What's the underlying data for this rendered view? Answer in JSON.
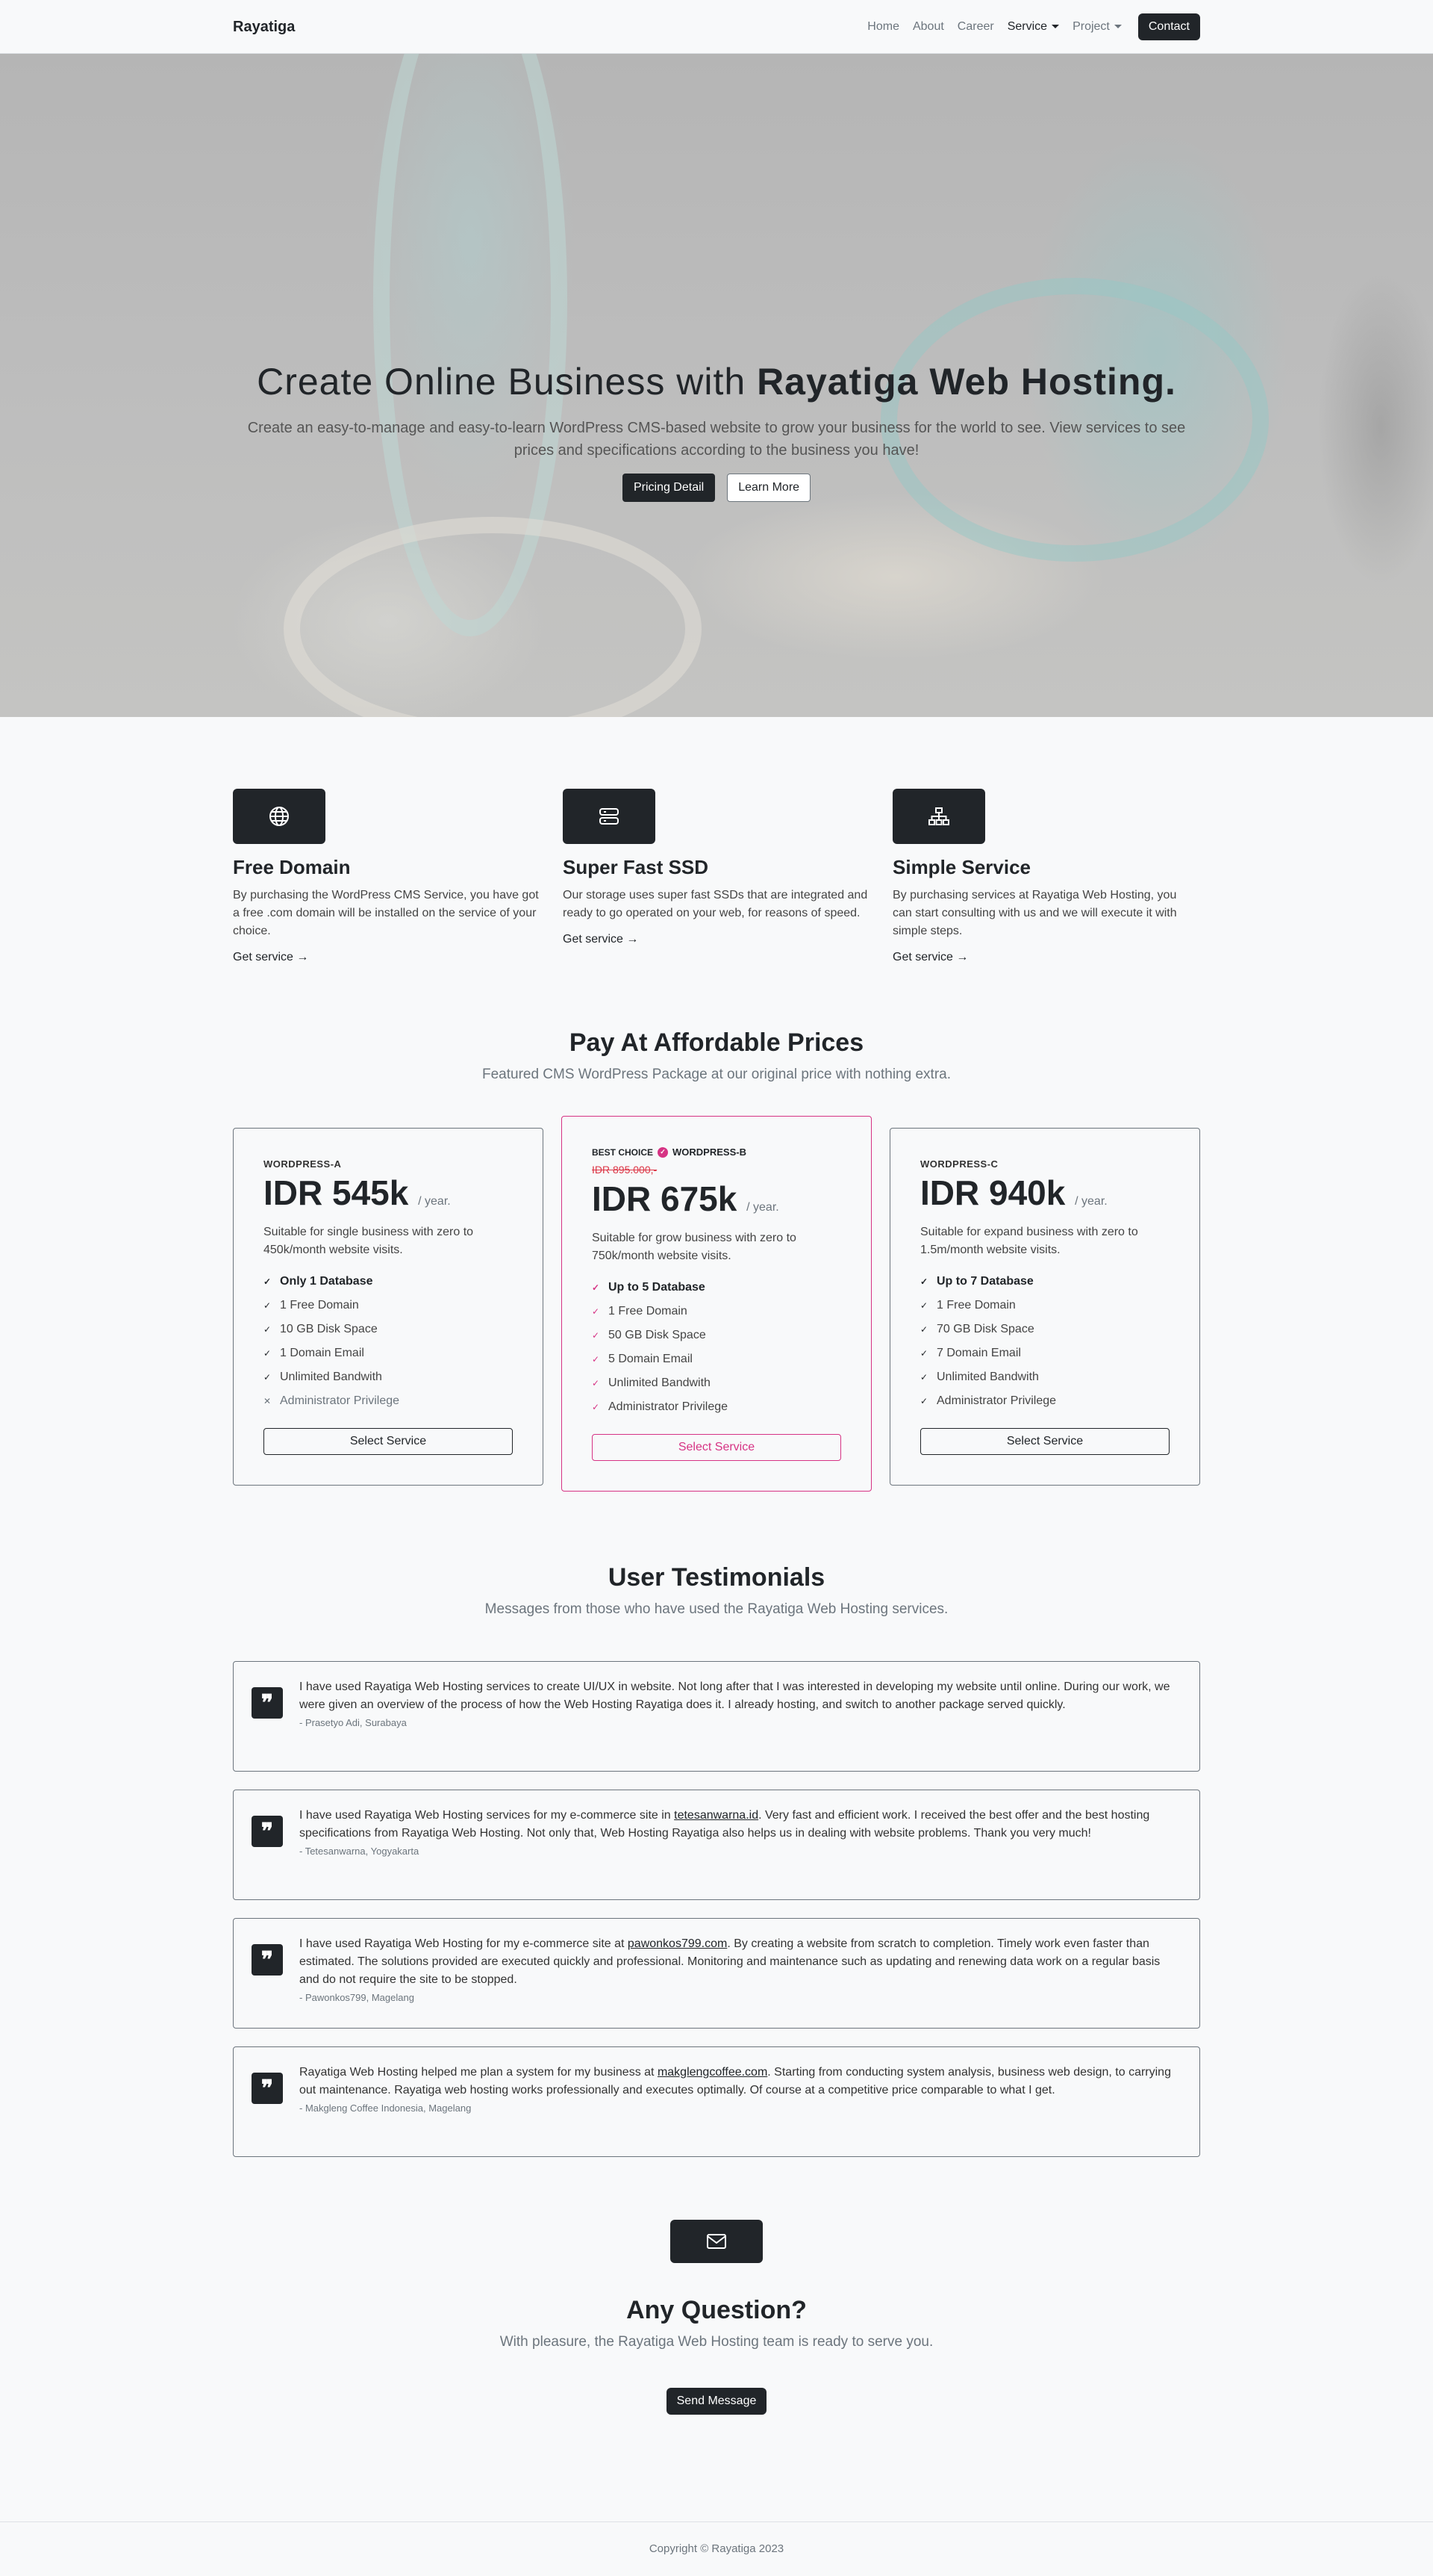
{
  "nav": {
    "brand": "Rayatiga",
    "links": [
      "Home",
      "About",
      "Career"
    ],
    "service": "Service",
    "project": "Project",
    "contact": "Contact"
  },
  "hero": {
    "title_plain": "Create Online Business with ",
    "title_bold": "Rayatiga Web Hosting.",
    "subtitle": "Create an easy-to-manage and easy-to-learn WordPress CMS-based website to grow your business for the world to see. View services to see prices and specifications according to the business you have!",
    "btn_primary": "Pricing Detail",
    "btn_secondary": "Learn More"
  },
  "features": [
    {
      "icon": "globe-icon",
      "title": "Free Domain",
      "text": "By purchasing the WordPress CMS Service, you have got a free .com domain will be installed on the service of your choice.",
      "link": "Get service"
    },
    {
      "icon": "server-icon",
      "title": "Super Fast SSD",
      "text": "Our storage uses super fast SSDs that are integrated and ready to go operated on your web, for reasons of speed.",
      "link": "Get service"
    },
    {
      "icon": "diagram-icon",
      "title": "Simple Service",
      "text": "By purchasing services at Rayatiga Web Hosting, you can start consulting with us and we will execute it with simple steps.",
      "link": "Get service"
    }
  ],
  "pricing": {
    "title": "Pay At Affordable Prices",
    "subtitle": "Featured CMS WordPress Package at our original price with nothing extra.",
    "plans": [
      {
        "name": "WORDPRESS-A",
        "price": "IDR 545k",
        "period": "/ year.",
        "desc": "Suitable for single business with zero to 450k/month website visits.",
        "items": [
          {
            "text": "Only 1 Database",
            "bold": true,
            "on": true
          },
          {
            "text": "1 Free Domain",
            "bold": false,
            "on": true
          },
          {
            "text": "10 GB Disk Space",
            "bold": false,
            "on": true
          },
          {
            "text": "1 Domain Email",
            "bold": false,
            "on": true
          },
          {
            "text": "Unlimited Bandwith",
            "bold": false,
            "on": true
          },
          {
            "text": "Administrator Privilege",
            "bold": false,
            "on": false
          }
        ],
        "button": "Select Service"
      },
      {
        "badge": "BEST CHOICE",
        "name": "WORDPRESS-B",
        "old_price": "IDR 895.000,-",
        "price": "IDR 675k",
        "period": "/ year.",
        "desc": "Suitable for grow business with zero to 750k/month website visits.",
        "items": [
          {
            "text": "Up to 5 Database",
            "bold": true,
            "on": true
          },
          {
            "text": "1 Free Domain",
            "bold": false,
            "on": true
          },
          {
            "text": "50 GB Disk Space",
            "bold": false,
            "on": true
          },
          {
            "text": "5 Domain Email",
            "bold": false,
            "on": true
          },
          {
            "text": "Unlimited Bandwith",
            "bold": false,
            "on": true
          },
          {
            "text": "Administrator Privilege",
            "bold": false,
            "on": true
          }
        ],
        "button": "Select Service"
      },
      {
        "name": "WORDPRESS-C",
        "price": "IDR 940k",
        "period": "/ year.",
        "desc": "Suitable for expand business with zero to 1.5m/month website visits.",
        "items": [
          {
            "text": "Up to 7 Database",
            "bold": true,
            "on": true
          },
          {
            "text": "1 Free Domain",
            "bold": false,
            "on": true
          },
          {
            "text": "70 GB Disk Space",
            "bold": false,
            "on": true
          },
          {
            "text": "7 Domain Email",
            "bold": false,
            "on": true
          },
          {
            "text": "Unlimited Bandwith",
            "bold": false,
            "on": true
          },
          {
            "text": "Administrator Privilege",
            "bold": false,
            "on": true
          }
        ],
        "button": "Select Service"
      }
    ]
  },
  "testimonials": {
    "title": "User Testimonials",
    "subtitle": "Messages from those who have used the Rayatiga Web Hosting services.",
    "items": [
      {
        "before": "I have used Rayatiga Web Hosting services to create UI/UX in website. Not long after that I was interested in developing my website until online. During our work, we were given an overview of the process of how the Web Hosting Rayatiga does it. I already hosting, and switch to another package served quickly.",
        "link": "",
        "after": "",
        "author": "- Prasetyo Adi, Surabaya"
      },
      {
        "before": "I have used Rayatiga Web Hosting services for my e-commerce site in ",
        "link": "tetesanwarna.id",
        "after": ". Very fast and efficient work. I received the best offer and the best hosting specifications from Rayatiga Web Hosting. Not only that, Web Hosting Rayatiga also helps us in dealing with website problems. Thank you very much!",
        "author": "- Tetesanwarna, Yogyakarta"
      },
      {
        "before": "I have used Rayatiga Web Hosting for my e-commerce site at ",
        "link": "pawonkos799.com",
        "after": ". By creating a website from scratch to completion. Timely work even faster than estimated. The solutions provided are executed quickly and professional. Monitoring and maintenance such as updating and renewing data work on a regular basis and do not require the site to be stopped.",
        "author": "- Pawonkos799, Magelang"
      },
      {
        "before": "Rayatiga Web Hosting helped me plan a system for my business at ",
        "link": "makglengcoffee.com",
        "after": ". Starting from conducting system analysis, business web design, to carrying out maintenance. Rayatiga web hosting works professionally and executes optimally. Of course at a competitive price comparable to what I get.",
        "author": "- Makgleng Coffee Indonesia, Magelang"
      }
    ]
  },
  "question": {
    "title": "Any Question?",
    "subtitle": "With pleasure, the Rayatiga Web Hosting team is ready to serve you.",
    "button": "Send Message"
  },
  "footer": {
    "copyright": "Copyright © Rayatiga 2023"
  },
  "colors": {
    "accent": "#d63384",
    "dark": "#212529",
    "muted": "#6c757d"
  }
}
